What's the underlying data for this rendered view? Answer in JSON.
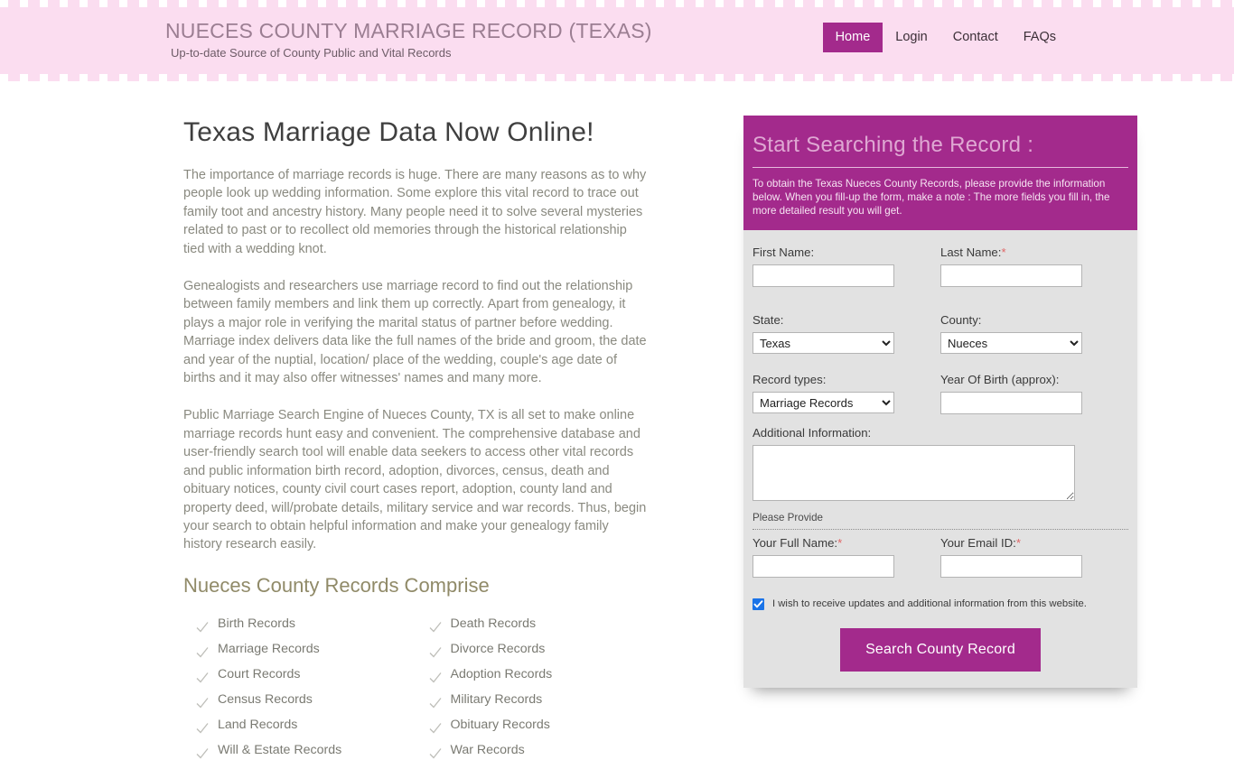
{
  "header": {
    "brand_title": "NUECES COUNTY MARRIAGE RECORD (TEXAS)",
    "brand_tagline": "Up-to-date Source of  County Public and Vital Records",
    "nav": [
      {
        "label": "Home",
        "active": true
      },
      {
        "label": "Login",
        "active": false
      },
      {
        "label": "Contact",
        "active": false
      },
      {
        "label": "FAQs",
        "active": false
      }
    ]
  },
  "main": {
    "page_title": "Texas Marriage Data Now Online!",
    "paragraphs": [
      "The importance of marriage records is huge. There are many reasons as to why people look up wedding information. Some explore this vital record to trace out family toot and ancestry history. Many people need it to solve several mysteries related to past or to recollect old memories through the historical relationship tied with a wedding knot.",
      "Genealogists and researchers use marriage record to find out the relationship between family members and link them up correctly. Apart from genealogy, it plays a major role in verifying the marital status of partner before wedding. Marriage index delivers data like the full names of the bride and groom, the date and year of the nuptial, location/ place of the wedding, couple's age date of births and it may also offer witnesses' names and many more.",
      "Public Marriage Search Engine of Nueces County, TX is all set to make online marriage records hunt easy and convenient. The comprehensive database and user-friendly search tool will enable data seekers to access other vital records and public information birth record, adoption, divorces, census, death and obituary notices, county civil court cases report, adoption, county land and property deed, will/probate details, military service and war records. Thus, begin your search to obtain helpful information and make your genealogy family history research easily."
    ],
    "records_section_title": "Nueces County Records Comprise",
    "records": [
      "Birth Records",
      "Death Records",
      "Marriage Records",
      "Divorce Records",
      "Court Records",
      "Adoption Records",
      "Census Records",
      "Military Records",
      "Land Records",
      "Obituary Records",
      "Will & Estate Records",
      "War Records"
    ]
  },
  "search_panel": {
    "title": "Start Searching the Record :",
    "description": "To obtain the Texas Nueces County Records, please provide the information below. When you fill-up the form, make a note : The more fields you fill in, the more detailed result you will get.",
    "fields": {
      "first_name_label": "First Name:",
      "first_name_value": "",
      "last_name_label": "Last Name:",
      "last_name_required": "*",
      "last_name_value": "",
      "state_label": "State:",
      "state_value": "Texas",
      "state_options": [
        "Texas"
      ],
      "county_label": "County:",
      "county_value": "Nueces",
      "county_options": [
        "Nueces"
      ],
      "record_types_label": "Record types:",
      "record_types_value": "Marriage Records",
      "record_types_options": [
        "Marriage Records"
      ],
      "year_of_birth_label": "Year Of Birth (approx):",
      "year_of_birth_value": "",
      "additional_info_label": "Additional Information:",
      "additional_info_value": "",
      "please_provide": "Please Provide",
      "full_name_label": "Your Full Name:",
      "full_name_required": "*",
      "full_name_value": "",
      "email_label": "Your Email ID:",
      "email_required": "*",
      "email_value": ""
    },
    "consent_label": "I wish to receive updates and additional information from this website.",
    "consent_checked": true,
    "submit_label": "Search County Record"
  },
  "colors": {
    "brand_magenta": "#a32a8c",
    "header_pink": "#fbddf0",
    "panel_gray": "#e2e2e2",
    "checkbox_blue": "#1a73e8",
    "required_red": "#e06666"
  }
}
